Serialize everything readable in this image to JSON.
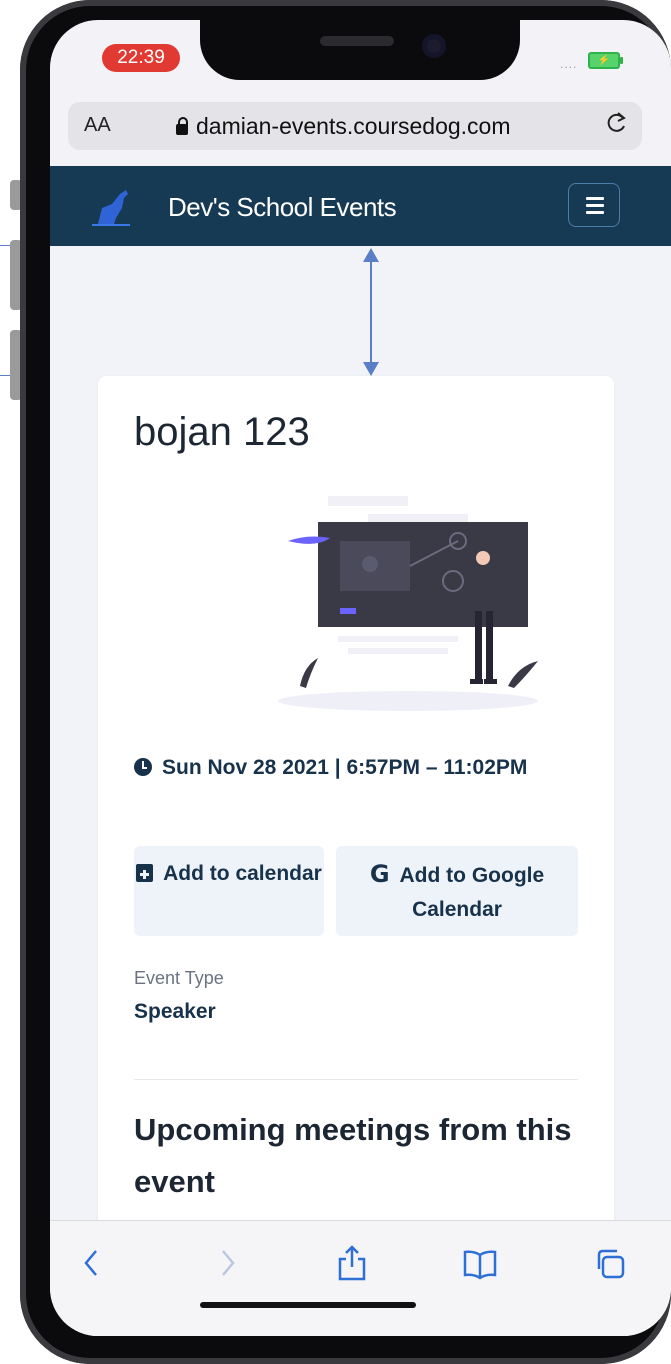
{
  "status_bar": {
    "time": "22:39",
    "signal": "....",
    "battery": "⚡"
  },
  "browser": {
    "text_size_label": "AA",
    "url": "damian-events.coursedog.com"
  },
  "site": {
    "title": "Dev's School Events"
  },
  "event": {
    "title": "bojan 123",
    "datetime": "Sun Nov 28 2021 | 6:57PM – 11:02PM",
    "add_to_calendar": "Add to calendar",
    "add_to_google": "Add to Google Calendar",
    "google_glyph": "G",
    "event_type_label": "Event Type",
    "event_type_value": "Speaker",
    "upcoming_heading": "Upcoming meetings from this event"
  },
  "colors": {
    "navbar": "#163a54",
    "accent_text": "#17324a",
    "time_pill": "#e03a33",
    "measure": "#5b7fc7"
  },
  "icons": {
    "back": "chevron-left-icon",
    "forward": "chevron-right-icon",
    "share": "share-icon",
    "bookmarks": "book-icon",
    "tabs": "tabs-icon"
  }
}
